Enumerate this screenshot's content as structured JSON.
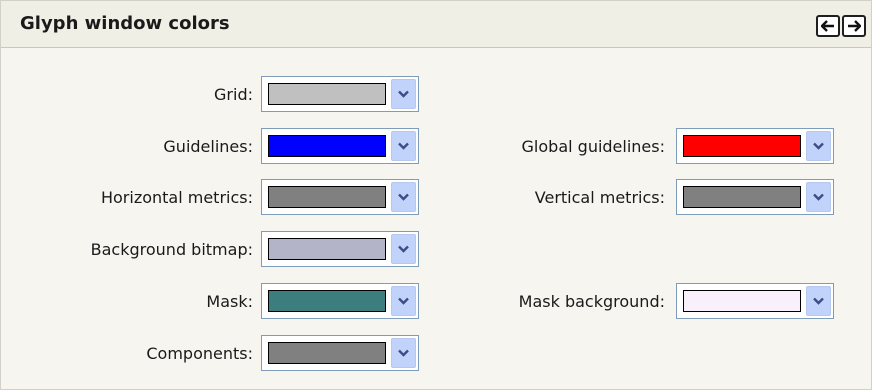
{
  "panel": {
    "title": "Glyph window colors",
    "nav": {
      "prev_icon": "arrow-left-icon",
      "next_icon": "arrow-right-icon"
    }
  },
  "colors": {
    "grid": {
      "label": "Grid:",
      "swatch": "#c0c0c0"
    },
    "guidelines": {
      "label": "Guidelines:",
      "swatch": "#0000ff"
    },
    "global_guidelines": {
      "label": "Global guidelines:",
      "swatch": "#ff0000"
    },
    "horizontal_metrics": {
      "label": "Horizontal metrics:",
      "swatch": "#808080"
    },
    "vertical_metrics": {
      "label": "Vertical metrics:",
      "swatch": "#808080"
    },
    "background_bitmap": {
      "label": "Background bitmap:",
      "swatch": "#b4b4c8"
    },
    "mask": {
      "label": "Mask:",
      "swatch": "#3c7d7d"
    },
    "mask_background": {
      "label": "Mask background:",
      "swatch": "#f8f0fa"
    },
    "components": {
      "label": "Components:",
      "swatch": "#808080"
    }
  },
  "dropdown_icon": "chevron-down-icon",
  "accent": "#7f9db9"
}
